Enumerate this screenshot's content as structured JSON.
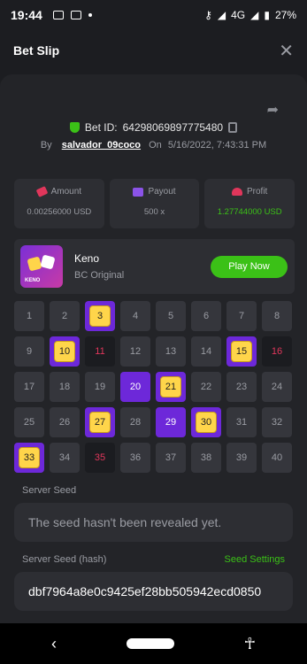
{
  "status": {
    "time": "19:44",
    "network": "4G",
    "battery": "27%"
  },
  "header": {
    "title": "Bet Slip",
    "close": "✕"
  },
  "bet": {
    "id_label": "Bet ID:",
    "id": "64298069897775480",
    "by": "By",
    "user": "salvador_09coco",
    "on": "On",
    "datetime": "5/16/2022, 7:43:31 PM"
  },
  "stats": {
    "amount_label": "Amount",
    "amount_value": "0.00256000 USD",
    "payout_label": "Payout",
    "payout_value": "500 x",
    "profit_label": "Profit",
    "profit_value": "1.27744000 USD"
  },
  "game": {
    "name": "Keno",
    "provider": "BC Original",
    "thumb_text": "KENO",
    "play_label": "Play Now"
  },
  "grid": [
    {
      "n": "1",
      "s": "n"
    },
    {
      "n": "2",
      "s": "n"
    },
    {
      "n": "3",
      "s": "hit"
    },
    {
      "n": "4",
      "s": "n"
    },
    {
      "n": "5",
      "s": "n"
    },
    {
      "n": "6",
      "s": "n"
    },
    {
      "n": "7",
      "s": "n"
    },
    {
      "n": "8",
      "s": "n"
    },
    {
      "n": "9",
      "s": "n"
    },
    {
      "n": "10",
      "s": "hit"
    },
    {
      "n": "11",
      "s": "miss"
    },
    {
      "n": "12",
      "s": "n"
    },
    {
      "n": "13",
      "s": "n"
    },
    {
      "n": "14",
      "s": "n"
    },
    {
      "n": "15",
      "s": "hit"
    },
    {
      "n": "16",
      "s": "miss"
    },
    {
      "n": "17",
      "s": "n"
    },
    {
      "n": "18",
      "s": "n"
    },
    {
      "n": "19",
      "s": "n"
    },
    {
      "n": "20",
      "s": "sel"
    },
    {
      "n": "21",
      "s": "hit"
    },
    {
      "n": "22",
      "s": "n"
    },
    {
      "n": "23",
      "s": "n"
    },
    {
      "n": "24",
      "s": "n"
    },
    {
      "n": "25",
      "s": "n"
    },
    {
      "n": "26",
      "s": "n"
    },
    {
      "n": "27",
      "s": "hit"
    },
    {
      "n": "28",
      "s": "n"
    },
    {
      "n": "29",
      "s": "sel"
    },
    {
      "n": "30",
      "s": "hit"
    },
    {
      "n": "31",
      "s": "n"
    },
    {
      "n": "32",
      "s": "n"
    },
    {
      "n": "33",
      "s": "hit"
    },
    {
      "n": "34",
      "s": "n"
    },
    {
      "n": "35",
      "s": "miss"
    },
    {
      "n": "36",
      "s": "n"
    },
    {
      "n": "37",
      "s": "n"
    },
    {
      "n": "38",
      "s": "n"
    },
    {
      "n": "39",
      "s": "n"
    },
    {
      "n": "40",
      "s": "n"
    }
  ],
  "seeds": {
    "server_label": "Server Seed",
    "server_value": "The seed hasn't been revealed yet.",
    "hash_label": "Server Seed (hash)",
    "settings_label": "Seed Settings",
    "hash_value": "dbf7964a8e0c9425ef28bb505942ecd0850"
  },
  "colors": {
    "accent": "#3bc117",
    "purple": "#6d28d9",
    "gold": "#ffd54a",
    "red": "#e0365b"
  }
}
